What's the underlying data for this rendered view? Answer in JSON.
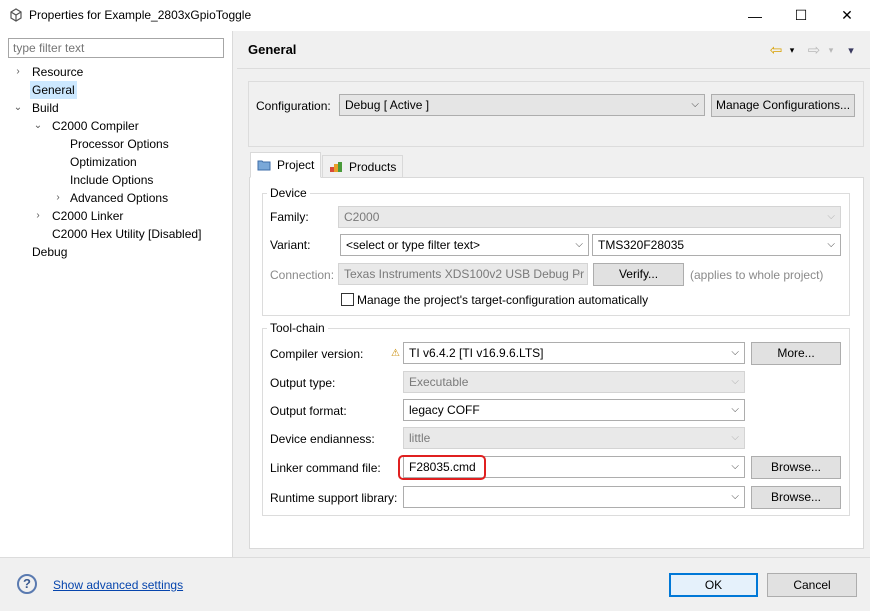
{
  "window": {
    "title": "Properties for Example_2803xGpioToggle",
    "minimize": "—",
    "maximize": "☐",
    "close": "✕"
  },
  "sidebar": {
    "filter_placeholder": "type filter text",
    "items": [
      {
        "label": "Resource",
        "arrow": "›"
      },
      {
        "label": "General"
      },
      {
        "label": "Build",
        "arrow": "⌄"
      },
      {
        "label": "C2000 Compiler",
        "arrow": "⌄"
      },
      {
        "label": "Processor Options"
      },
      {
        "label": "Optimization"
      },
      {
        "label": "Include Options"
      },
      {
        "label": "Advanced Options",
        "arrow": "›"
      },
      {
        "label": "C2000 Linker",
        "arrow": "›"
      },
      {
        "label": "C2000 Hex Utility  [Disabled]"
      },
      {
        "label": "Debug"
      }
    ],
    "selected": "General"
  },
  "header": {
    "title": "General",
    "back": "⇦",
    "forward": "⇨",
    "menu": "▾"
  },
  "configuration": {
    "label": "Configuration:",
    "value": "Debug  [ Active ]",
    "manage_button": "Manage Configurations..."
  },
  "tabs": [
    {
      "label": "Project",
      "active": true
    },
    {
      "label": "Products",
      "active": false
    }
  ],
  "device": {
    "group_title": "Device",
    "family_label": "Family:",
    "family_value": "C2000",
    "variant_label": "Variant:",
    "variant_filter": "<select or type filter text>",
    "variant_value": "TMS320F28035",
    "connection_label": "Connection:",
    "connection_value": "Texas Instruments XDS100v2 USB Debug Pr",
    "verify_button": "Verify...",
    "applies_note": "(applies to whole project)",
    "manage_checkbox_label": "Manage the project's target-configuration automatically",
    "manage_checked": false
  },
  "toolchain": {
    "group_title": "Tool-chain",
    "compiler_label": "Compiler version:",
    "compiler_value": "TI v6.4.2  [TI v16.9.6.LTS]",
    "more_button": "More...",
    "output_type_label": "Output type:",
    "output_type_value": "Executable",
    "output_format_label": "Output format:",
    "output_format_value": "legacy COFF",
    "endianness_label": "Device endianness:",
    "endianness_value": "little",
    "linker_cmd_label": "Linker command file:",
    "linker_cmd_value": "F28035.cmd",
    "browse_button": "Browse...",
    "runtime_label": "Runtime support library:",
    "runtime_value": "",
    "browse_button2": "Browse..."
  },
  "footer": {
    "help": "?",
    "advanced_link": "Show advanced settings",
    "ok": "OK",
    "cancel": "Cancel"
  },
  "colors": {
    "accent": "#0078d7",
    "selection": "#cce8ff",
    "highlight": "#e02020",
    "link": "#0645ad"
  }
}
